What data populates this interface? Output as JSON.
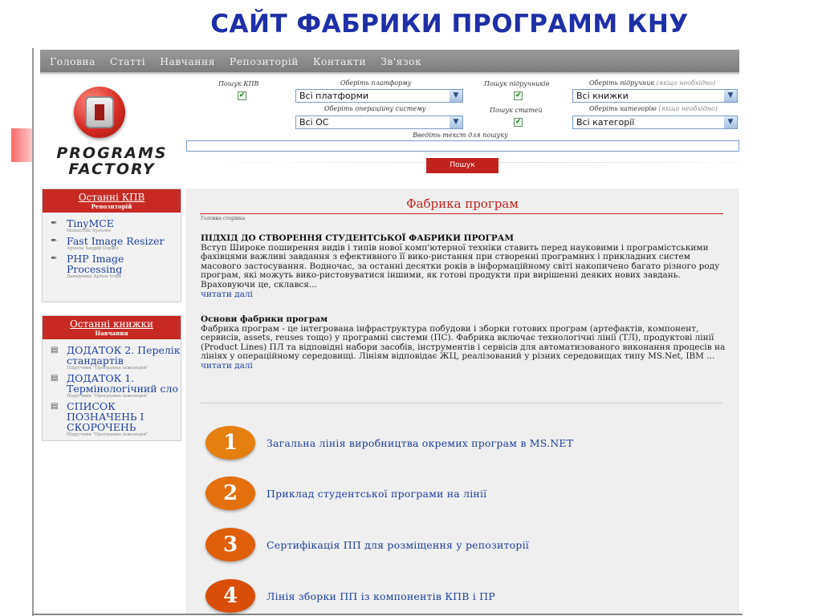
{
  "slide": {
    "title": "САЙТ ФАБРИКИ ПРОГРАММ КНУ"
  },
  "nav": {
    "items": [
      "Головна",
      "Статті",
      "Навчання",
      "Репозиторій",
      "Контакти",
      "Зв'язок"
    ]
  },
  "logo": {
    "line1": "PROGRAMS",
    "line2": "FACTORY"
  },
  "search": {
    "kpv_label": "Пошук КПВ",
    "platform_label": "Оберіть платформу",
    "platform_value": "Всі платформи",
    "textbooks_label": "Пошук підручників",
    "textbook_select_label": "Оберіть підручник",
    "optional": "(якщо необхідно)",
    "textbook_value": "Всі книжки",
    "os_label": "Оберіть операційну систему",
    "os_value": "Всі ОС",
    "articles_label": "Пошук статей",
    "category_label": "Оберіть категорію",
    "category_value": "Всі категорії",
    "text_label": "Введіть текст для пошуку",
    "button": "Пошук"
  },
  "sidebar_kpv": {
    "title": "Останні КПВ",
    "subtitle": "Репозиторій",
    "items": [
      {
        "title": "TinyMCE",
        "meta": "Moxiecode Systems"
      },
      {
        "title": "Fast Image Resizer",
        "meta": "Архипа Андрій Олексі"
      },
      {
        "title": "PHP Image Processing",
        "meta": "Давиденко Артем Ігоре"
      }
    ]
  },
  "sidebar_books": {
    "title": "Останні книжки",
    "subtitle": "Навчання",
    "items": [
      {
        "title": "ДОДАТОК 2. Перелік стандартів",
        "meta": "Підручник \"Програмна інженерія\""
      },
      {
        "title": "ДОДАТОК 1. Термінологічний сло",
        "meta": "Підручник \"Програмна інженерія\""
      },
      {
        "title": "СПИСОК ПОЗНАЧЕНЬ І СКОРОЧЕНЬ",
        "meta": "Підручник \"Програмна інженерія\""
      }
    ]
  },
  "main": {
    "heading": "Фабрика програм",
    "breadcrumb": "Головна сторінка",
    "article1": {
      "title": "ПІДХІД ДО СТВОРЕННЯ СТУДЕНТСЬКОЇ ФАБРИКИ ПРОГРАМ",
      "body": "Вступ Широке поширення видів і типів нової комп'ютерної техніки ставить перед науковими і програмістськими фахівцями важливі завдання з ефективного її вико-ристання при створенні програмних і прикладних систем масового застосування. Водночас, за останні десятки років в інформаційному світі накопичено багато різного роду програм, які можуть вико-ристовуватися іншими, як готові продукти при вирішенні деяких нових завдань. Враховуючи це, склався...",
      "more": "читати далі"
    },
    "article2": {
      "title": "Основи фабрики програм",
      "body": "Фабрика програм - це інтегрована інфраструктура побудови і зборки готових програм (артефактів, компонент, сервисів, assets, reuses тощо) у програмні системи (ПС). Фабрика включає технологічні лінії (ТЛ), продуктові лінії (Product Lines) ПЛ та відповідні набори засобів, інструментів і сервісів для автоматизованого виконання процесів на лініях у операційному середовищі. Лініям відповідає ЖЦ, реалізований у різних середовищах типу MS.Net, IBM ...",
      "more": "читати далі"
    },
    "steps": [
      {
        "num": "1",
        "label": "Загальна лінія виробництва окремих програм в MS.NET",
        "color": "#e57f0f"
      },
      {
        "num": "2",
        "label": "Приклад студентської програми на лінії",
        "color": "#e3700d"
      },
      {
        "num": "3",
        "label": "Сертифікація ПП для розміщення у репозиторії",
        "color": "#df5f0b"
      },
      {
        "num": "4",
        "label": "Лінія зборки ПП із компонентів КПВ і ПР",
        "color": "#d94f08"
      }
    ]
  }
}
